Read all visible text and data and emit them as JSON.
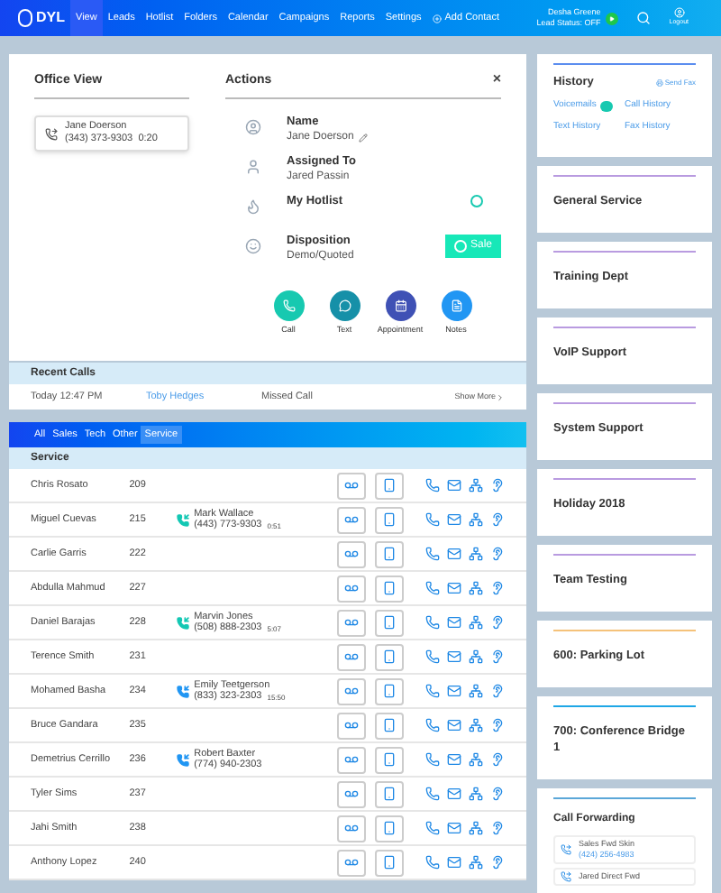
{
  "nav": {
    "logo": "DYL",
    "items": [
      {
        "label": "View",
        "selected": true
      },
      {
        "label": "Leads",
        "selected": false
      },
      {
        "label": "Hotlist",
        "selected": false
      },
      {
        "label": "Folders",
        "selected": false
      },
      {
        "label": "Calendar",
        "selected": false
      },
      {
        "label": "Campaigns",
        "selected": false
      },
      {
        "label": "Reports",
        "selected": false
      },
      {
        "label": "Settings",
        "selected": false
      }
    ],
    "add_contact": "Add Contact",
    "user": {
      "name": "Desha Greene",
      "status": "Lead Status: OFF",
      "online": true
    },
    "logout": "Logout"
  },
  "office_view": {
    "title": "Office View",
    "call": {
      "name": "Jane Doerson",
      "phone": "(343) 373-9303",
      "duration": "0:20"
    }
  },
  "actions": {
    "title": "Actions",
    "close": "×",
    "fields": [
      {
        "kind": "name",
        "label": "Name",
        "value": "Jane Doerson"
      },
      {
        "kind": "assigned",
        "label": "Assigned To",
        "value": "Jared Passin"
      },
      {
        "kind": "hotlist",
        "label": "My Hotlist",
        "on": false
      },
      {
        "kind": "disposition",
        "label": "Disposition",
        "value": "Demo/Quoted",
        "button": "Sale"
      }
    ],
    "buttons": [
      {
        "kind": "call",
        "label": "Call"
      },
      {
        "kind": "text",
        "label": "Text"
      },
      {
        "kind": "appointment",
        "label": "Appointment"
      },
      {
        "kind": "notes",
        "label": "Notes"
      }
    ]
  },
  "recent_calls": {
    "title": "Recent Calls",
    "rows": [
      {
        "time": "Today 12:47 PM",
        "name": "Toby Hedges",
        "status": "Missed Call"
      }
    ],
    "show_more": "Show More"
  },
  "directory": {
    "tabs": [
      {
        "label": "All",
        "selected": false
      },
      {
        "label": "Sales",
        "selected": false
      },
      {
        "label": "Tech",
        "selected": false
      },
      {
        "label": "Other",
        "selected": false
      },
      {
        "label": "Service",
        "selected": true
      }
    ],
    "section": "Service",
    "rows": [
      {
        "name": "Chris Rosato",
        "ext": "209"
      },
      {
        "name": "Miguel Cuevas",
        "ext": "215",
        "call": {
          "name": "Mark Wallace",
          "phone": "(443) 773-9303",
          "duration": "0:51",
          "color": "#14c8b4"
        }
      },
      {
        "name": "Carlie Garris",
        "ext": "222"
      },
      {
        "name": "Abdulla Mahmud",
        "ext": "227"
      },
      {
        "name": "Daniel Barajas",
        "ext": "228",
        "call": {
          "name": "Marvin Jones",
          "phone": "(508) 888-2303",
          "duration": "5:07",
          "color": "#14c8b4"
        }
      },
      {
        "name": "Terence Smith",
        "ext": "231"
      },
      {
        "name": "Mohamed Basha",
        "ext": "234",
        "call": {
          "name": "Emily Teetgerson",
          "phone": "(833) 323-2303",
          "duration": "15:50",
          "color": "#2196f3"
        }
      },
      {
        "name": "Bruce Gandara",
        "ext": "235"
      },
      {
        "name": "Demetrius Cerrillo",
        "ext": "236",
        "call": {
          "name": "Robert Baxter",
          "phone": "(774) 940-2303",
          "color": "#2196f3"
        }
      },
      {
        "name": "Tyler Sims",
        "ext": "237"
      },
      {
        "name": "Jahi Smith",
        "ext": "238"
      },
      {
        "name": "Anthony Lopez",
        "ext": "240"
      }
    ]
  },
  "history": {
    "title": "History",
    "send_fax": "Send Fax",
    "links": [
      "Voicemails",
      "Call History",
      "Text History",
      "Fax History"
    ],
    "color": "#5b8def"
  },
  "groups": [
    {
      "name": "General Service",
      "color": "#b99be0"
    },
    {
      "name": "Training Dept",
      "color": "#b99be0"
    },
    {
      "name": "VoIP Support",
      "color": "#b99be0"
    },
    {
      "name": "System Support",
      "color": "#b99be0"
    },
    {
      "name": "Holiday 2018",
      "color": "#b99be0"
    },
    {
      "name": "Team Testing",
      "color": "#b99be0"
    },
    {
      "name": "600: Parking Lot",
      "color": "#f5c27a"
    },
    {
      "name": "700: Conference Bridge 1",
      "color": "#1ea7e6"
    }
  ],
  "call_forwarding": {
    "title": "Call Forwarding",
    "color": "#5ba7d8",
    "items": [
      {
        "name": "Sales Fwd Skin",
        "phone": "(424) 256-4983"
      },
      {
        "name": "Jared Direct Fwd"
      }
    ]
  }
}
